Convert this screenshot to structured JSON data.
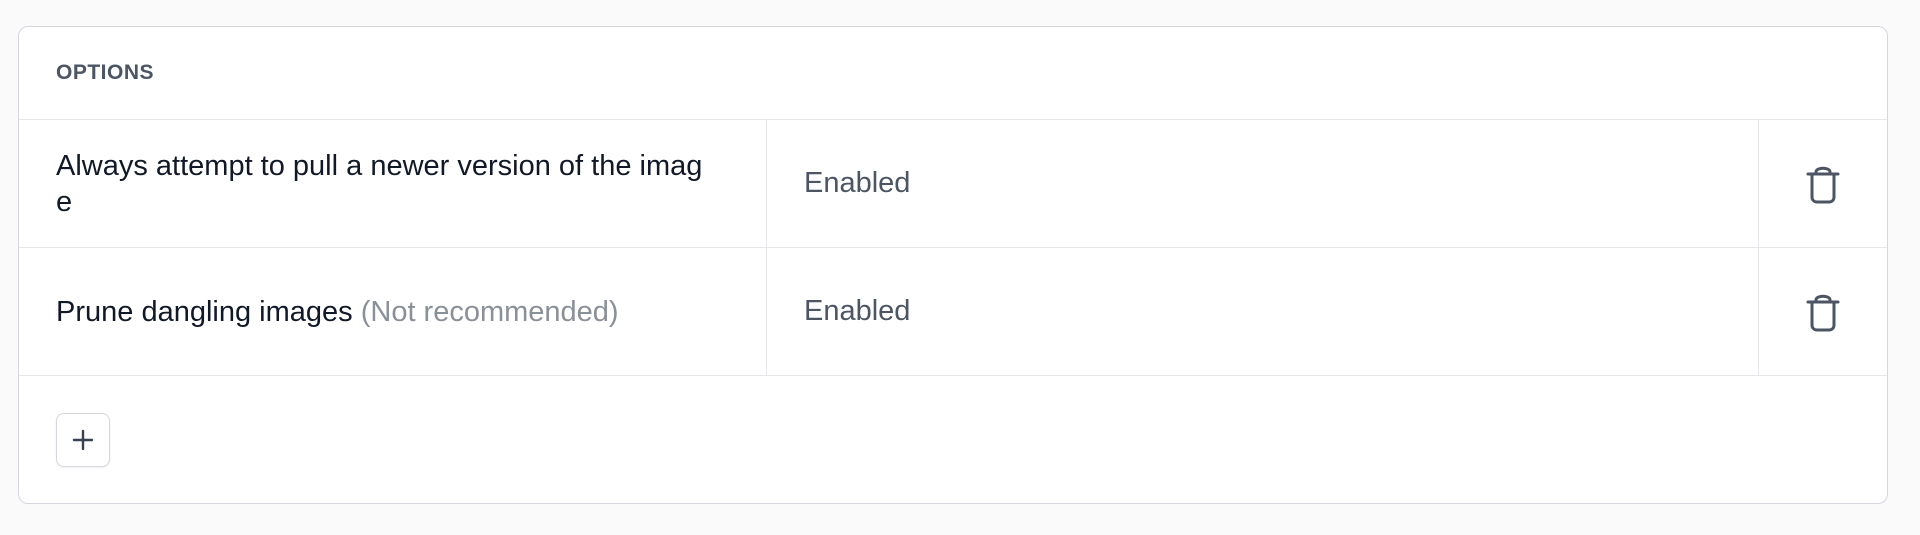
{
  "options_card": {
    "title": "OPTIONS",
    "rows": [
      {
        "name": "Always attempt to pull a newer version of the image",
        "note": "",
        "value": "Enabled",
        "action_icon": "trash-icon"
      },
      {
        "name": "Prune dangling images",
        "note": "(Not recommended)",
        "value": "Enabled",
        "action_icon": "trash-icon"
      }
    ],
    "add_icon": "plus-icon"
  },
  "colors": {
    "background": "#fafafa",
    "card": "#ffffff",
    "border": "#d4d7dd",
    "divider": "#e5e7eb",
    "text_primary": "#111827",
    "text_secondary": "#4b5563",
    "text_muted": "#8a9099"
  }
}
